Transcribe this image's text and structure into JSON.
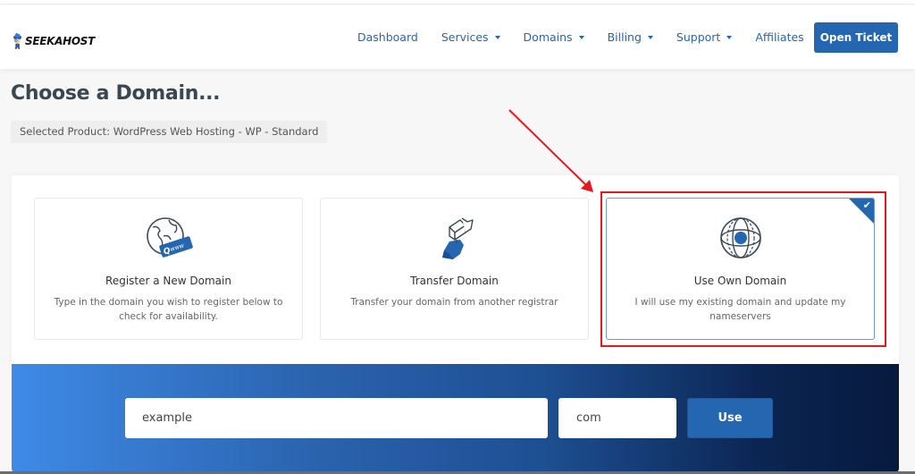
{
  "header": {
    "logo_text": "SEEKAHOST",
    "nav": [
      {
        "label": "Dashboard",
        "dropdown": false
      },
      {
        "label": "Services",
        "dropdown": true
      },
      {
        "label": "Domains",
        "dropdown": true
      },
      {
        "label": "Billing",
        "dropdown": true
      },
      {
        "label": "Support",
        "dropdown": true
      },
      {
        "label": "Affiliates",
        "dropdown": false
      }
    ],
    "open_ticket_label": "Open Ticket"
  },
  "page": {
    "title": "Choose a Domain...",
    "selected_product": "Selected Product: WordPress Web Hosting - WP - Standard"
  },
  "options": [
    {
      "title": "Register a New Domain",
      "description": "Type in the domain you wish to register below to check for availability.",
      "icon": "globe-www-icon",
      "selected": false
    },
    {
      "title": "Transfer Domain",
      "description": "Transfer your domain from another registrar",
      "icon": "transfer-icon",
      "selected": false
    },
    {
      "title": "Use Own Domain",
      "description": "I will use my existing domain and update my nameservers",
      "icon": "globe-target-icon",
      "selected": true
    }
  ],
  "search": {
    "domain_value": "example",
    "tld_value": "com",
    "button_label": "Use"
  },
  "colors": {
    "brand": "#2466b0",
    "annotation": "#e8161d",
    "title": "#3a4650"
  }
}
